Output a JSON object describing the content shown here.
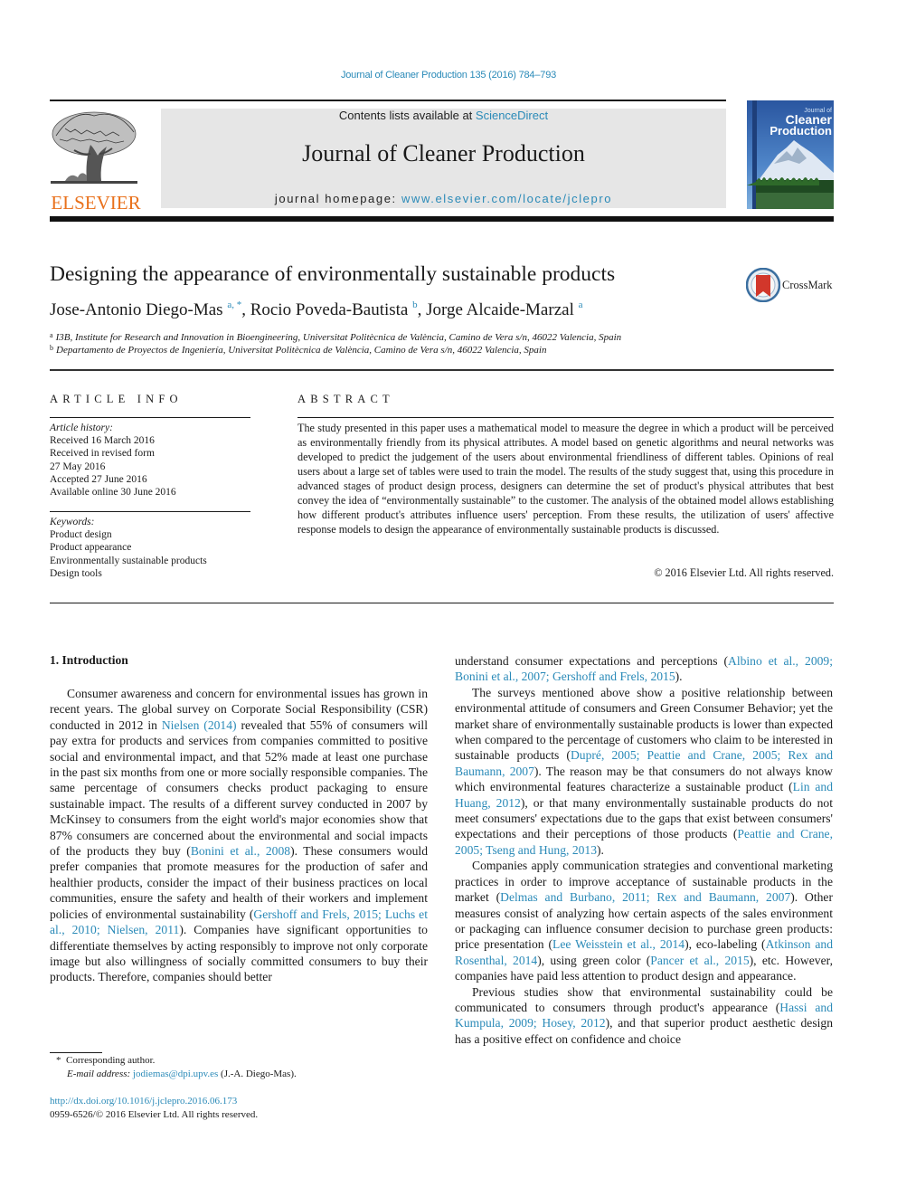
{
  "header": {
    "citation": "Journal of Cleaner Production 135 (2016) 784–793",
    "contents_prefix": "Contents lists available at ",
    "contents_link": "ScienceDirect",
    "journal_name": "Journal of Cleaner Production",
    "homepage_prefix": "journal homepage: ",
    "homepage_link": "www.elsevier.com/locate/jclepro",
    "publisher_logo_text": "ELSEVIER",
    "cover": {
      "line1": "Journal of",
      "line2": "Cleaner",
      "line3": "Production"
    },
    "colors": {
      "link": "#2a8ab8",
      "elsevier_orange": "#e9711c",
      "band_gray": "#e6e6e6"
    }
  },
  "article": {
    "title": "Designing the appearance of environmentally sustainable products",
    "crossmark_label": "CrossMark",
    "authors": [
      {
        "name": "Jose-Antonio Diego-Mas",
        "sup": "a, *",
        "sep": ", "
      },
      {
        "name": "Rocio Poveda-Bautista",
        "sup": "b",
        "sep": ", "
      },
      {
        "name": "Jorge Alcaide-Marzal",
        "sup": "a",
        "sep": ""
      }
    ],
    "affiliations": [
      {
        "key": "a",
        "text": "I3B, Institute for Research and Innovation in Bioengineering, Universitat Politècnica de València, Camino de Vera s/n, 46022 Valencia, Spain"
      },
      {
        "key": "b",
        "text": "Departamento de Proyectos de Ingeniería, Universitat Politècnica de València, Camino de Vera s/n, 46022 Valencia, Spain"
      }
    ]
  },
  "article_info": {
    "heading": "ARTICLE INFO",
    "history_label": "Article history:",
    "history": [
      "Received 16 March 2016",
      "Received in revised form",
      "27 May 2016",
      "Accepted 27 June 2016",
      "Available online 30 June 2016"
    ],
    "keywords_label": "Keywords:",
    "keywords": [
      "Product design",
      "Product appearance",
      "Environmentally sustainable products",
      "Design tools"
    ]
  },
  "abstract": {
    "heading": "ABSTRACT",
    "text": "The study presented in this paper uses a mathematical model to measure the degree in which a product will be perceived as environmentally friendly from its physical attributes. A model based on genetic algorithms and neural networks was developed to predict the judgement of the users about environmental friendliness of different tables. Opinions of real users about a large set of tables were used to train the model. The results of the study suggest that, using this procedure in advanced stages of product design process, designers can determine the set of product's physical attributes that best convey the idea of “environmentally sustainable” to the customer. The analysis of the obtained model allows establishing how different product's attributes influence users' perception. From these results, the utilization of users' affective response models to design the appearance of environmentally sustainable products is discussed.",
    "copyright": "© 2016 Elsevier Ltd. All rights reserved."
  },
  "body": {
    "section_heading": "1.  Introduction",
    "left_paragraphs": [
      [
        {
          "t": "Consumer awareness and concern for environmental issues has grown in recent years. The global survey on Corporate Social Responsibility (CSR) conducted in 2012 in "
        },
        {
          "t": "Nielsen (2014)",
          "link": true
        },
        {
          "t": " revealed that 55% of consumers will pay extra for products and services from companies committed to positive social and environmental impact, and that 52% made at least one purchase in the past six months from one or more socially responsible companies. The same percentage of consumers checks product packaging to ensure sustainable impact. The results of a different survey conducted in 2007 by McKinsey to consumers from the eight world's major economies show that 87% consumers are concerned about the environmental and social impacts of the products they buy ("
        },
        {
          "t": "Bonini et al., 2008",
          "link": true
        },
        {
          "t": "). These consumers would prefer companies that promote measures for the production of safer and healthier products, consider the impact of their business practices on local communities, ensure the safety and health of their workers and implement policies of environmental sustainability ("
        },
        {
          "t": "Gershoff and Frels, 2015; Luchs et al., 2010; Nielsen, 2011",
          "link": true
        },
        {
          "t": "). Companies have significant opportunities to differentiate themselves by acting responsibly to improve not only corporate image but also willingness of socially committed consumers to buy their products. Therefore, companies should better"
        }
      ]
    ],
    "right_paragraphs": [
      [
        {
          "t": "understand consumer expectations and perceptions ("
        },
        {
          "t": "Albino et al., 2009; Bonini et al., 2007; Gershoff and Frels, 2015",
          "link": true
        },
        {
          "t": ")."
        }
      ],
      [
        {
          "t": "The surveys mentioned above show a positive relationship between environmental attitude of consumers and Green Consumer Behavior; yet the market share of environmentally sustainable products is lower than expected when compared to the percentage of customers who claim to be interested in sustainable products ("
        },
        {
          "t": "Dupré, 2005; Peattie and Crane, 2005; Rex and Baumann, 2007",
          "link": true
        },
        {
          "t": "). The reason may be that consumers do not always know which environmental features characterize a sustainable product ("
        },
        {
          "t": "Lin and Huang, 2012",
          "link": true
        },
        {
          "t": "), or that many environmentally sustainable products do not meet consumers' expectations due to the gaps that exist between consumers' expectations and their perceptions of those products ("
        },
        {
          "t": "Peattie and Crane, 2005; Tseng and Hung, 2013",
          "link": true
        },
        {
          "t": ")."
        }
      ],
      [
        {
          "t": "Companies apply communication strategies and conventional marketing practices in order to improve acceptance of sustainable products in the market ("
        },
        {
          "t": "Delmas and Burbano, 2011; Rex and Baumann, 2007",
          "link": true
        },
        {
          "t": "). Other measures consist of analyzing how certain aspects of the sales environment or packaging can influence consumer decision to purchase green products: price presentation ("
        },
        {
          "t": "Lee Weisstein et al., 2014",
          "link": true
        },
        {
          "t": "), eco-labeling ("
        },
        {
          "t": "Atkinson and Rosenthal, 2014",
          "link": true
        },
        {
          "t": "), using green color ("
        },
        {
          "t": "Pancer et al., 2015",
          "link": true
        },
        {
          "t": "), etc. However, companies have paid less attention to product design and appearance."
        }
      ],
      [
        {
          "t": "Previous studies show that environmental sustainability could be communicated to consumers through product's appearance ("
        },
        {
          "t": "Hassi and Kumpula, 2009; Hosey, 2012",
          "link": true
        },
        {
          "t": "), and that superior product aesthetic design has a positive effect on confidence and choice"
        }
      ]
    ]
  },
  "footnotes": {
    "corresponding_marker": "*",
    "corresponding": "Corresponding author.",
    "email_label": "E-mail address:",
    "email": "jodiemas@dpi.upv.es",
    "email_owner": " (J.-A. Diego-Mas).",
    "doi": "http://dx.doi.org/10.1016/j.jclepro.2016.06.173",
    "issn": "0959-6526/© 2016 Elsevier Ltd. All rights reserved."
  }
}
